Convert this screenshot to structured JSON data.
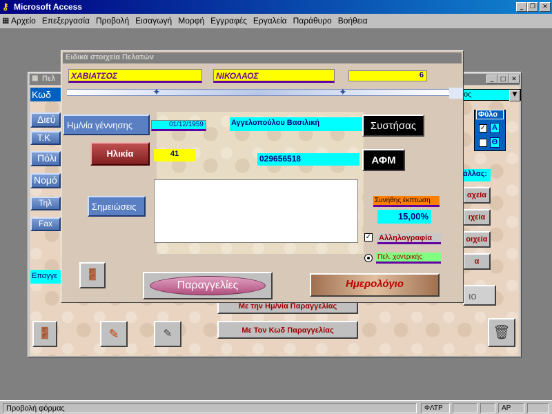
{
  "app": {
    "title": "Microsoft Access"
  },
  "menu": [
    "Αρχείο",
    "Επεξεργασία",
    "Προβολή",
    "Εισαγωγή",
    "Μορφή",
    "Εγγραφές",
    "Εργαλεία",
    "Παράθυρο",
    "Βοήθεια"
  ],
  "back_form": {
    "title": "Πελ",
    "kod_label": "Κωδ",
    "combo_value": "ος",
    "left_labels": [
      "Διεύ",
      "Τ.Κ",
      "Πόλι",
      "Νομό",
      "Τηλ",
      "Fax"
    ],
    "epaggelma": "Επαγγε",
    "fylo_label": "Φύλο",
    "fylo_A": "Α",
    "fylo_TH": "Θ",
    "allos_label": "άλλας:",
    "right_btns": [
      "αχεία",
      "ιχεία",
      "οιχεία",
      "α"
    ],
    "side_btn": "ιο",
    "order_btns": [
      "Με την Ημ/νία Παραγγελίας",
      "Με Τον Κωδ Παραγγελίας"
    ]
  },
  "dialog": {
    "title": "Ειδικά στοιχεία Πελατών",
    "surname": "ΧΑΒΙΑΤΣΟΣ",
    "name": "ΝΙΚΟΛΑΟΣ",
    "code": "6",
    "birthdate_label": "Ημ/νία γέννησης",
    "birthdate": "01/12/1959",
    "recommender": "Αγγελοπούλου Βασιλική",
    "recommender_btn": "Συστήσας",
    "age_label": "Ηλικία",
    "age": "41",
    "afm": "029656518",
    "afm_btn": "ΑΦΜ",
    "notes_label": "Σημειώσεις",
    "notes": "",
    "discount_label": "Συνήθης έκπτωση",
    "discount": "15,00%",
    "correspondence": "Αλληλογραφία",
    "contractor": "Πελ. χοντρικής",
    "orders_btn": "Παραγγελίες",
    "calendar_btn": "Ημερολόγιο"
  },
  "status": {
    "text": "Προβολή φόρμας",
    "fltr": "ΦΛΤΡ",
    "ar": "ΑΡ"
  }
}
